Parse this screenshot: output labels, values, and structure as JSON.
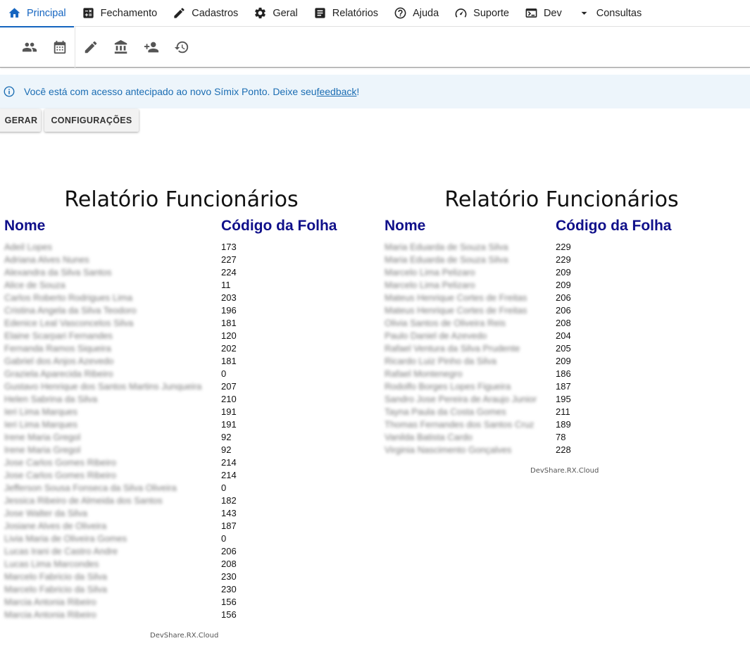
{
  "nav": {
    "items": [
      {
        "label": "Principal",
        "icon": "home-icon",
        "active": true
      },
      {
        "label": "Fechamento",
        "icon": "calculator-icon"
      },
      {
        "label": "Cadastros",
        "icon": "pencil-icon"
      },
      {
        "label": "Geral",
        "icon": "gear-icon"
      },
      {
        "label": "Relatórios",
        "icon": "document-icon"
      },
      {
        "label": "Ajuda",
        "icon": "help-icon"
      },
      {
        "label": "Suporte",
        "icon": "speedometer-icon"
      },
      {
        "label": "Dev",
        "icon": "terminal-icon"
      },
      {
        "label": "Consultas",
        "icon": "caret-down-icon"
      }
    ],
    "accent_color": "#1565c0"
  },
  "toolbar": {
    "icons": [
      "people-icon",
      "calendar-icon",
      "edit-icon",
      "building-icon",
      "add-person-icon",
      "history-icon"
    ]
  },
  "banner": {
    "text": "Você está com acesso antecipado ao novo Símix Ponto. Deixe seu ",
    "link": "feedback",
    "suffix": "!",
    "color": "#1b6db3",
    "background": "#edf5fb"
  },
  "buttons": {
    "gerar": "GERAR",
    "configuracoes": "CONFIGURAÇÕES"
  },
  "reports": [
    {
      "title": "Relatório Funcionários",
      "col_name": "Nome",
      "col_code": "Código da Folha",
      "watermark": "DevShare.RX.Cloud",
      "rows": [
        {
          "name": "Adeil Lopes",
          "code": "173"
        },
        {
          "name": "Adriana Alves Nunes",
          "code": "227"
        },
        {
          "name": "Alexandra da Silva Santos",
          "code": "224"
        },
        {
          "name": "Alice de Souza",
          "code": "11"
        },
        {
          "name": "Carlos Roberto Rodrigues Lima",
          "code": "203"
        },
        {
          "name": "Cristina Angela da Silva Teodoro",
          "code": "196"
        },
        {
          "name": "Edenice Leal Vasconcelos Silva",
          "code": "181"
        },
        {
          "name": "Elaine Scarpari Fernandes",
          "code": "120"
        },
        {
          "name": "Fernanda Ramos Siqueira",
          "code": "202"
        },
        {
          "name": "Gabriel dos Anjos Azevedo",
          "code": "181"
        },
        {
          "name": "Graziela Aparecida Ribeiro",
          "code": "0"
        },
        {
          "name": "Gustavo Henrique dos Santos Martins Junqueira",
          "code": "207"
        },
        {
          "name": "Helen Sabrina da Silva",
          "code": "210"
        },
        {
          "name": "Ieri Lima Marques",
          "code": "191"
        },
        {
          "name": "Ieri Lima Marques",
          "code": "191"
        },
        {
          "name": "Irene Maria Gregol",
          "code": "92"
        },
        {
          "name": "Irene Maria Gregol",
          "code": "92"
        },
        {
          "name": "Jose Carlos Gomes Ribeiro",
          "code": "214"
        },
        {
          "name": "Jose Carlos Gomes Ribeiro",
          "code": "214"
        },
        {
          "name": "Jefferson Sousa Fonseca da Silva Oliveira",
          "code": "0"
        },
        {
          "name": "Jessica Ribeiro de Almeida dos Santos",
          "code": "182"
        },
        {
          "name": "Jose Walter da Silva",
          "code": "143"
        },
        {
          "name": "Josiane Alves de Oliveira",
          "code": "187"
        },
        {
          "name": "Livia Maria de Oliveira Gomes",
          "code": "0"
        },
        {
          "name": "Lucas Irani de Castro Andre",
          "code": "206"
        },
        {
          "name": "Lucas Lima Marcondes",
          "code": "208"
        },
        {
          "name": "Marcelo Fabricio da Silva",
          "code": "230"
        },
        {
          "name": "Marcelo Fabricio da Silva",
          "code": "230"
        },
        {
          "name": "Marcia Antonia Ribeiro",
          "code": "156"
        },
        {
          "name": "Marcia Antonia Ribeiro",
          "code": "156"
        }
      ]
    },
    {
      "title": "Relatório Funcionários",
      "col_name": "Nome",
      "col_code": "Código da Folha",
      "watermark": "DevShare.RX.Cloud",
      "rows": [
        {
          "name": "Maria Eduarda de Souza Silva",
          "code": "229"
        },
        {
          "name": "Maria Eduarda de Souza Silva",
          "code": "229"
        },
        {
          "name": "Marcelo Lima Pelizaro",
          "code": "209"
        },
        {
          "name": "Marcelo Lima Pelizaro",
          "code": "209"
        },
        {
          "name": "Mateus Henrique Cortes de Freitas",
          "code": "206"
        },
        {
          "name": "Mateus Henrique Cortes de Freitas",
          "code": "206"
        },
        {
          "name": "Olivia Santos de Oliveira Reis",
          "code": "208"
        },
        {
          "name": "Paulo Daniel de Azevedo",
          "code": "204"
        },
        {
          "name": "Rafael Ventura da Silva Prudente",
          "code": "205"
        },
        {
          "name": "Ricardo Luiz Pinho da Silva",
          "code": "209"
        },
        {
          "name": "Rafael Montenegro",
          "code": "186"
        },
        {
          "name": "Rodolfo Borges Lopes Figueira",
          "code": "187"
        },
        {
          "name": "Sandro Jose Pereira de Araujo Junior",
          "code": "195"
        },
        {
          "name": "Tayna Paula da Costa Gomes",
          "code": "211"
        },
        {
          "name": "Thomas Fernandes dos Santos Cruz",
          "code": "189"
        },
        {
          "name": "Vanilda Batista Cardo",
          "code": "78"
        },
        {
          "name": "Virginia Nascimento Gonçalves",
          "code": "228"
        }
      ]
    }
  ]
}
